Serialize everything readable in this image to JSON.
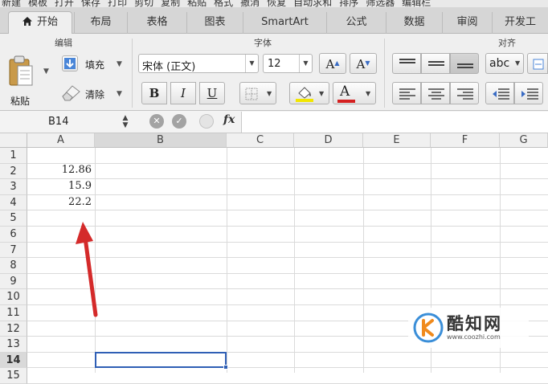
{
  "top_toolbar": [
    "新建",
    "模板",
    "打开",
    "保存",
    "打印",
    "剪切",
    "复制",
    "粘贴",
    "格式",
    "撤消",
    "恢复",
    "自动求和",
    "排序",
    "筛选器",
    "编辑栏"
  ],
  "tabs": [
    "开始",
    "布局",
    "表格",
    "图表",
    "SmartArt",
    "公式",
    "数据",
    "审阅",
    "开发工"
  ],
  "ribbon": {
    "edit_group_title": "编辑",
    "paste_label": "粘贴",
    "fill_label": "填充",
    "clear_label": "清除",
    "font_group_title": "字体",
    "font_name": "宋体 (正文)",
    "font_size": "12",
    "bold": "B",
    "italic": "I",
    "underline": "U",
    "grow_font": "A",
    "shrink_font": "A",
    "font_color_letter": "A",
    "align_group_title": "对齐",
    "wrap_label": "abc"
  },
  "formula_bar": {
    "name_box": "B14",
    "fx_label": "fx",
    "formula": ""
  },
  "columns": [
    "A",
    "B",
    "C",
    "D",
    "E",
    "F",
    "G"
  ],
  "rows": [
    "1",
    "2",
    "3",
    "4",
    "5",
    "6",
    "7",
    "8",
    "9",
    "10",
    "11",
    "12",
    "13",
    "14",
    "15"
  ],
  "cells": [
    {
      "ref": "A2",
      "value": "12.86"
    },
    {
      "ref": "A3",
      "value": "15.9"
    },
    {
      "ref": "A4",
      "value": "22.2"
    }
  ],
  "selected_cell": "B14",
  "watermark": {
    "title": "酷知网",
    "url": "www.coozhi.com"
  },
  "colors": {
    "accent": "#2f5fb5",
    "arrow": "#d42a2a",
    "font_color_bar": "#d42020",
    "highlight_bar": "#f2e600"
  }
}
